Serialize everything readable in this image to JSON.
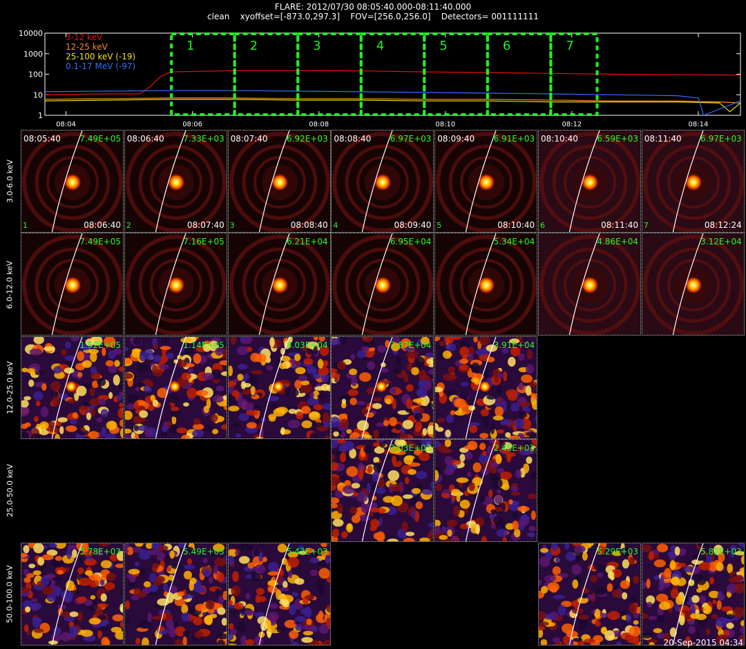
{
  "header": {
    "title": "FLARE: 2012/07/30 08:05:40.000-08:11:40.000",
    "subtitle": "clean    xyoffset=[-873.0,297.3]    FOV=[256.0,256.0]    Detectors= 001111111"
  },
  "stamp": "20-Sep-2015 04:34",
  "chart_data": [
    {
      "type": "line",
      "title": "",
      "xlabel": "",
      "ylabel": "",
      "yscale": "log",
      "ylim": [
        1,
        10000
      ],
      "xlim": [
        "08:03:40",
        "08:14:40"
      ],
      "y_ticks": [
        "1",
        "10",
        "100",
        "1000",
        "10000"
      ],
      "x_ticks": [
        "08:04",
        "08:06",
        "08:08",
        "08:10",
        "08:12",
        "08:14"
      ],
      "legend_position": "top-left",
      "series": [
        {
          "name": "3-12 keV",
          "color": "#e81010",
          "x": [
            "08:03:40",
            "08:04:30",
            "08:05:10",
            "08:05:20",
            "08:05:30",
            "08:05:40",
            "08:06:40",
            "08:07:40",
            "08:08:40",
            "08:09:40",
            "08:10:40",
            "08:11:40",
            "08:12:40",
            "08:13:40",
            "08:14:40"
          ],
          "y": [
            10,
            11,
            11,
            25,
            80,
            130,
            150,
            150,
            145,
            130,
            120,
            110,
            100,
            95,
            90
          ]
        },
        {
          "name": "12-25 keV",
          "color": "#ff8c10",
          "x": [
            "08:03:40",
            "08:04:40",
            "08:05:40",
            "08:06:40",
            "08:07:40",
            "08:08:40",
            "08:09:40",
            "08:10:40",
            "08:11:40",
            "08:12:40",
            "08:13:40",
            "08:14:20",
            "08:14:40"
          ],
          "y": [
            6,
            6.5,
            7,
            7,
            6.5,
            6.5,
            6,
            6,
            5.5,
            5,
            5,
            4.5,
            4
          ]
        },
        {
          "name": "25-100 keV (-19)",
          "color": "#f0e020",
          "x": [
            "08:03:40",
            "08:04:40",
            "08:05:40",
            "08:06:40",
            "08:07:40",
            "08:08:40",
            "08:09:40",
            "08:10:40",
            "08:11:40",
            "08:12:40",
            "08:13:40",
            "08:14:20",
            "08:14:30",
            "08:14:40"
          ],
          "y": [
            5,
            5.5,
            6,
            6,
            5.5,
            5.5,
            5,
            5,
            4.5,
            4.5,
            4.5,
            4,
            1.5,
            4
          ]
        },
        {
          "name": "0.1-17 MeV (-97)",
          "color": "#3070ff",
          "x": [
            "08:03:40",
            "08:04:40",
            "08:05:40",
            "08:06:40",
            "08:07:40",
            "08:08:40",
            "08:09:40",
            "08:10:40",
            "08:11:40",
            "08:12:40",
            "08:13:40",
            "08:14:00",
            "08:14:05",
            "08:14:40"
          ],
          "y": [
            14,
            15,
            16,
            16,
            15,
            14,
            13,
            12,
            11,
            10,
            9,
            7,
            1,
            5
          ]
        }
      ],
      "intervals": [
        {
          "label": "1",
          "start": "08:05:40",
          "end": "08:06:40"
        },
        {
          "label": "2",
          "start": "08:06:40",
          "end": "08:07:40"
        },
        {
          "label": "3",
          "start": "08:07:40",
          "end": "08:08:40"
        },
        {
          "label": "4",
          "start": "08:08:40",
          "end": "08:09:40"
        },
        {
          "label": "5",
          "start": "08:09:40",
          "end": "08:10:40"
        },
        {
          "label": "6",
          "start": "08:10:40",
          "end": "08:11:40"
        },
        {
          "label": "7",
          "start": "08:11:40",
          "end": "08:12:24"
        }
      ]
    },
    {
      "type": "heatmap",
      "title": "",
      "rows": [
        "3.0-6.0 keV",
        "6.0-12.0 keV",
        "12.0-25.0 keV",
        "25.0-50.0 keV",
        "50.0-100.0 keV"
      ],
      "columns": [
        {
          "index": "1",
          "start": "08:05:40",
          "end": "08:06:40"
        },
        {
          "index": "2",
          "start": "08:06:40",
          "end": "08:07:40"
        },
        {
          "index": "3",
          "start": "08:07:40",
          "end": "08:08:40"
        },
        {
          "index": "4",
          "start": "08:08:40",
          "end": "08:09:40"
        },
        {
          "index": "5",
          "start": "08:09:40",
          "end": "08:10:40"
        },
        {
          "index": "6",
          "start": "08:10:40",
          "end": "08:11:40"
        },
        {
          "index": "7",
          "start": "08:11:40",
          "end": "08:12:24"
        }
      ],
      "max_values": [
        [
          "7.49E+05",
          "7.33E+03",
          "6.92E+03",
          "6.97E+03",
          "6.91E+03",
          "6.59E+03",
          "6.97E+03"
        ],
        [
          "7.49E+05",
          "7.16E+05",
          "6.21E+04",
          "6.95E+04",
          "5.34E+04",
          "4.86E+04",
          "3.12E+04"
        ],
        [
          "1.52E+05",
          "1.14E+05",
          "8.03E+04",
          "7.87E+04",
          "3.91E+04",
          null,
          null
        ],
        [
          null,
          null,
          null,
          "3.03E+03",
          "2.45E+03",
          null,
          null
        ],
        [
          "5.78E+03",
          "5.49E+03",
          "5.43E+03",
          null,
          null,
          "5.29E+03",
          "5.82E+03"
        ]
      ]
    }
  ]
}
